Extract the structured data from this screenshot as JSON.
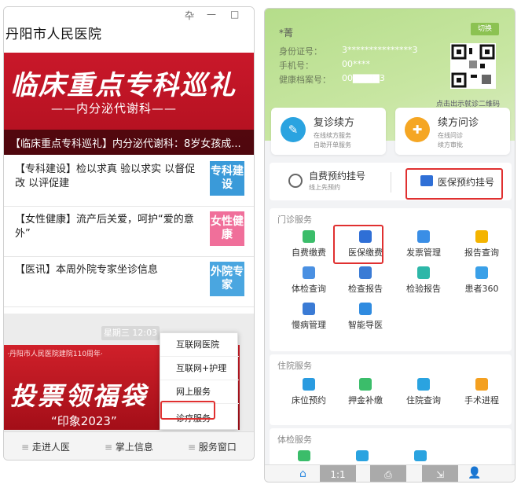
{
  "left": {
    "window_title": "丹阳市人民医院",
    "window_controls": [
      "卆",
      "—",
      "□"
    ],
    "banner": {
      "title": "临床重点专科巡礼",
      "subtitle": "——内分泌代谢科——",
      "caption": "【临床重点专科巡礼】内分泌代谢科：8岁女孩成..."
    },
    "news": [
      {
        "text": "【专科建设】检以求真 验以求实 以督促改 以评促建",
        "thumb": "专科建设",
        "thumb_color": "#3a9ad9"
      },
      {
        "text": "【女性健康】流产后关爱，呵护“爱的意外”",
        "thumb": "女性健康",
        "thumb_color": "#f06f9a"
      },
      {
        "text": "【医讯】本周外院专家坐诊信息",
        "thumb": "外院专家",
        "thumb_color": "#4aa6e0"
      }
    ],
    "timestamp": "星期三 12:03",
    "promo": {
      "top_text": "·丹阳市人民医院建院110周年·",
      "title": "投票领福袋",
      "subtitle": "“印象2023”"
    },
    "popup_menu": [
      "互联网医院",
      "互联网+护理",
      "网上服务",
      "诊疗服务"
    ],
    "bottom_nav": [
      "走进人医",
      "掌上信息",
      "服务窗口"
    ]
  },
  "right": {
    "switch_label": "切换",
    "patient": {
      "name": "*菁",
      "id_label": "身份证号：",
      "id_value": "3***************3",
      "phone_label": "手机号：",
      "phone_value": "00****",
      "record_label": "健康档案号：",
      "record_value": "00▇▇▇▇3"
    },
    "qr_hint": "点击出示就诊二维码",
    "service_cards": [
      {
        "title": "复诊续方",
        "sub1": "在线续方服务",
        "sub2": "自助开单服务",
        "icon_color": "#2aa3e0",
        "icon": "✎"
      },
      {
        "title": "续方问诊",
        "sub1": "在线问诊",
        "sub2": "续方审批",
        "icon_color": "#f5a623",
        "icon": "✚"
      }
    ],
    "registration": [
      {
        "title": "自费预约挂号",
        "sub": "线上先预约"
      },
      {
        "title": "医保预约挂号",
        "sub": ""
      }
    ],
    "outpatient": {
      "title": "门诊服务",
      "items": [
        {
          "label": "自费缴费",
          "color": "#3bbd6a"
        },
        {
          "label": "医保缴费",
          "color": "#2f6fd6"
        },
        {
          "label": "发票管理",
          "color": "#3a8ee6"
        },
        {
          "label": "报告查询",
          "color": "#f4b400"
        },
        {
          "label": "体检查询",
          "color": "#4a90e2"
        },
        {
          "label": "检查报告",
          "color": "#3a7bd5"
        },
        {
          "label": "检验报告",
          "color": "#2db7a8"
        },
        {
          "label": "患者360",
          "color": "#3aa0e8"
        },
        {
          "label": "慢病管理",
          "color": "#3a7bd5"
        },
        {
          "label": "智能导医",
          "color": "#2f8be0"
        }
      ]
    },
    "inpatient": {
      "title": "住院服务",
      "items": [
        {
          "label": "床位预约",
          "color": "#2a9be0"
        },
        {
          "label": "押金补缴",
          "color": "#3bbd6a"
        },
        {
          "label": "住院查询",
          "color": "#2aa3e0"
        },
        {
          "label": "手术进程",
          "color": "#f4a020"
        }
      ]
    },
    "physical": {
      "title": "体检服务"
    },
    "bottom_tabs": [
      "1:1"
    ]
  }
}
